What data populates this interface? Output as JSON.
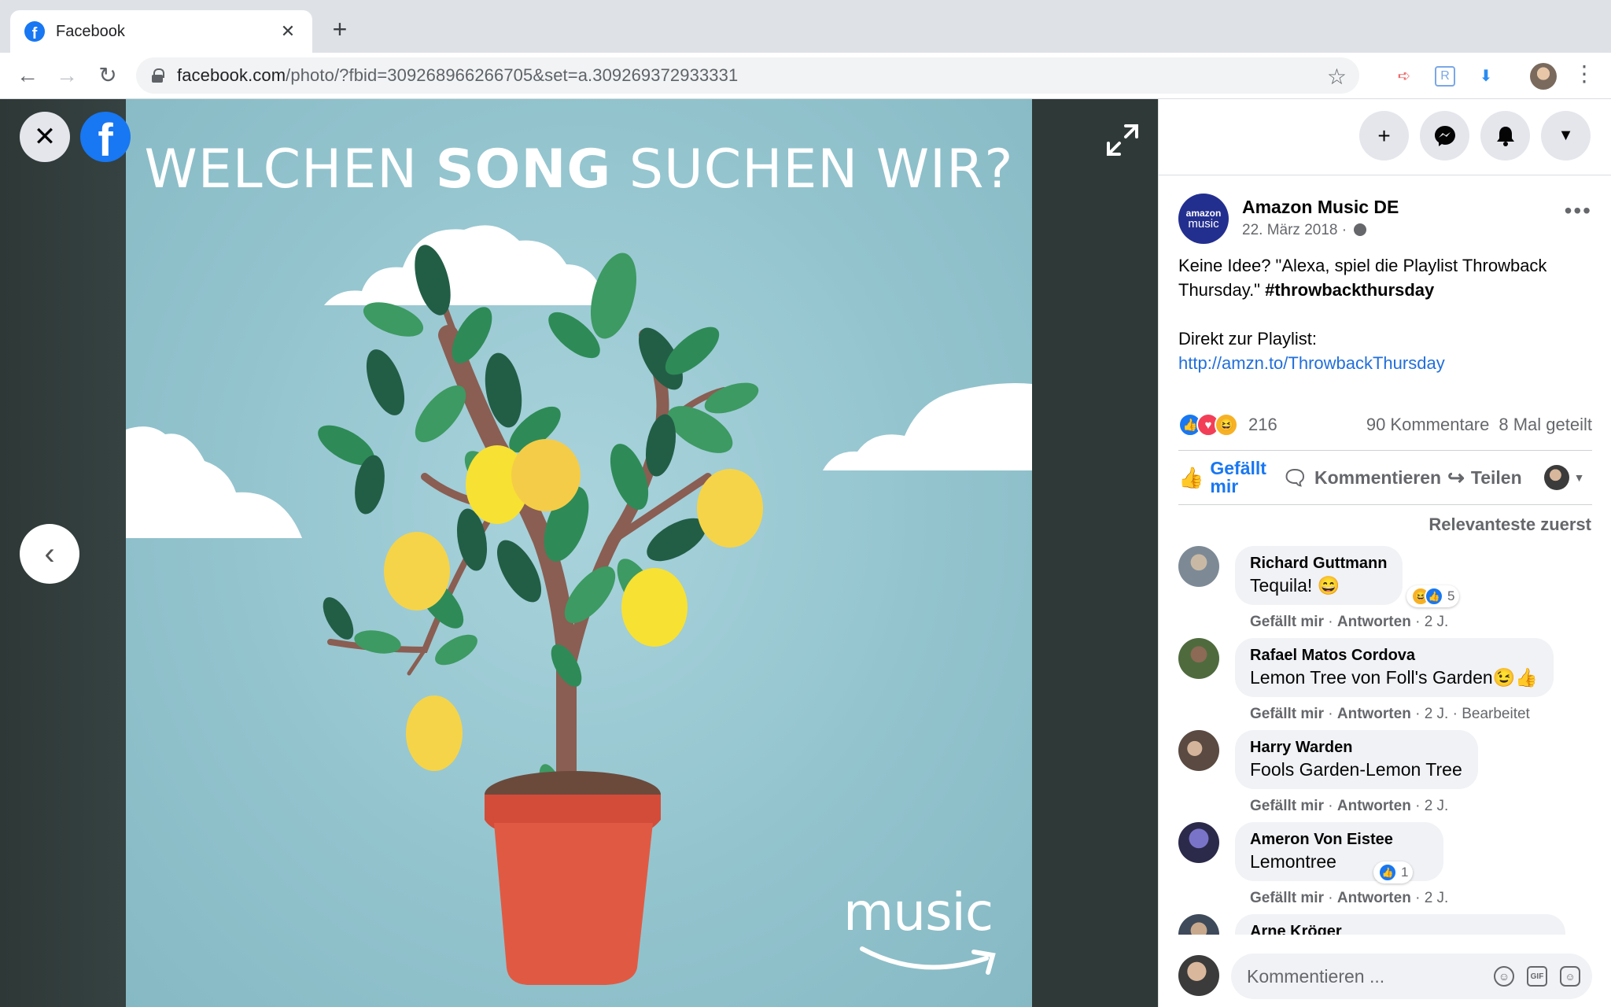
{
  "browser": {
    "tab_title": "Facebook",
    "url_host": "facebook.com",
    "url_path": "/photo/?fbid=309268966266705&set=a.309269372933331"
  },
  "photo": {
    "headline_part1": "WELCHEN ",
    "headline_bold": "SONG",
    "headline_part2": " SUCHEN WIR?",
    "logo_word": "music",
    "colors": {
      "sky": "#93c4ce",
      "leaf": "#2e8b57",
      "lemon": "#f7d548",
      "pot": "#e05a43"
    }
  },
  "post": {
    "page_name": "Amazon Music DE",
    "avatar_line1": "amazon",
    "avatar_line2": "music",
    "date": "22. März 2018 · ",
    "more": "•••",
    "text_line1": "Keine Idee? \"Alexa, spiel die Playlist Throwback Thursday.\" ",
    "hashtag": "#throwbackthursday",
    "text_line2": "Direkt zur Playlist:",
    "link": "http://amzn.to/ThrowbackThursday",
    "reactions_count": "216",
    "comments_count": "90 Kommentare",
    "shares_count": "8 Mal geteilt"
  },
  "actions": {
    "like": "Gefällt mir",
    "comment": "Kommentieren",
    "share": "Teilen"
  },
  "sort_label": "Relevanteste zuerst",
  "comments": [
    {
      "name": "Richard Guttmann",
      "text": "Tequila! 😄",
      "like": "Gefällt mir",
      "reply": "Antworten",
      "time": "2 J.",
      "extra": "",
      "react_count": "5"
    },
    {
      "name": "Rafael Matos Cordova",
      "text": "Lemon Tree von Foll's Garden😉👍",
      "like": "Gefällt mir",
      "reply": "Antworten",
      "time": "2 J.",
      "extra": "Bearbeitet",
      "react_count": ""
    },
    {
      "name": "Harry Warden",
      "text": "Fools Garden-Lemon Tree",
      "like": "Gefällt mir",
      "reply": "Antworten",
      "time": "2 J.",
      "extra": "",
      "react_count": ""
    },
    {
      "name": "Ameron Von Eistee",
      "text": "Lemontree",
      "like": "Gefällt mir",
      "reply": "Antworten",
      "time": "2 J.",
      "extra": "",
      "react_count": "1"
    },
    {
      "name": "Arne Kröger",
      "text": "",
      "like": "",
      "reply": "",
      "time": "",
      "extra": "",
      "react_count": ""
    }
  ],
  "composer": {
    "placeholder": "Kommentieren ...",
    "gif": "GIF"
  }
}
